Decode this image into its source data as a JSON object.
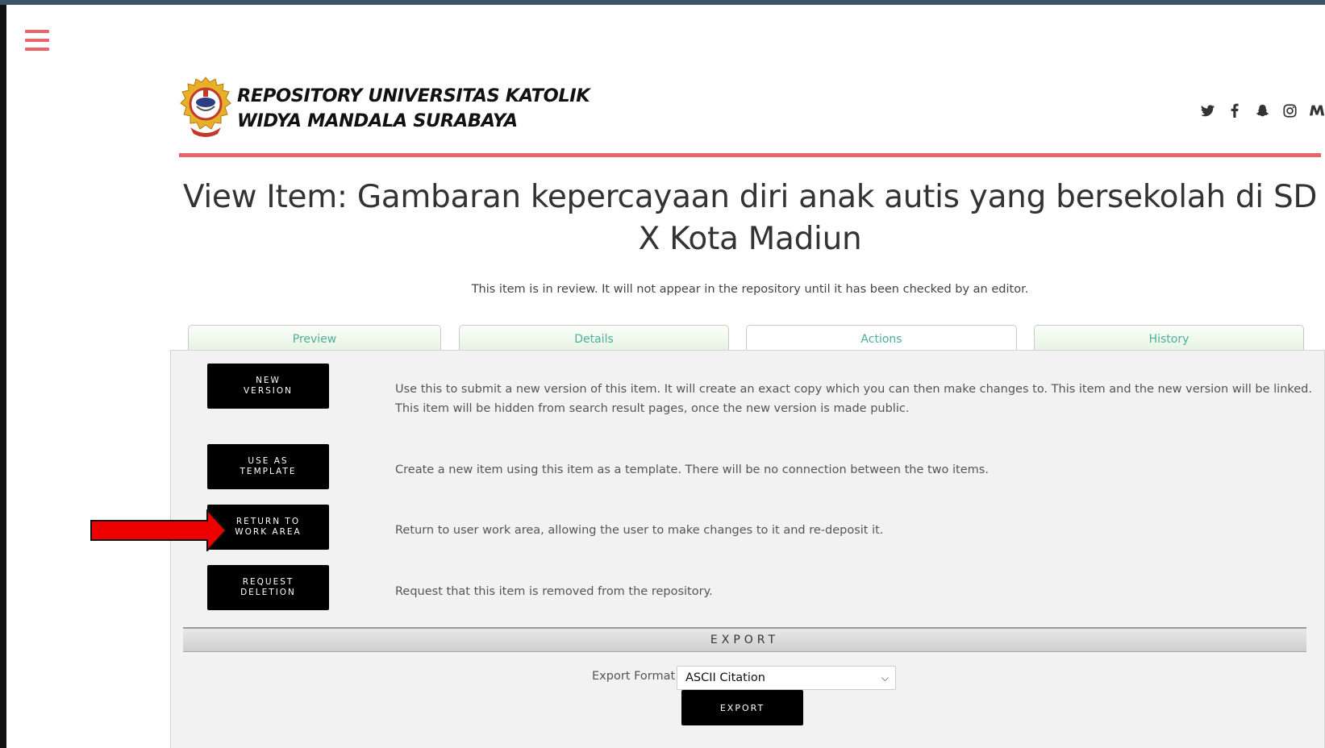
{
  "header": {
    "menu_icon": "hamburger-icon",
    "brand_line1": "REPOSITORY UNIVERSITAS KATOLIK",
    "brand_line2": "WIDYA MANDALA SURABAYA",
    "social": [
      {
        "name": "twitter-icon",
        "glyph": "🐦"
      },
      {
        "name": "facebook-icon",
        "glyph": "f"
      },
      {
        "name": "snapchat-icon",
        "glyph": "👻"
      },
      {
        "name": "instagram-icon",
        "glyph": "◎"
      },
      {
        "name": "mendeley-icon",
        "glyph": "M"
      }
    ],
    "accent_color": "#e8636a"
  },
  "page": {
    "title": "View Item: Gambaran kepercayaan diri anak autis yang bersekolah di SD X Kota Madiun",
    "review_note": "This item is in review. It will not appear in the repository until it has been checked by an editor."
  },
  "tabs": [
    {
      "label": "Preview"
    },
    {
      "label": "Details"
    },
    {
      "label": "Actions",
      "active": true
    },
    {
      "label": "History"
    }
  ],
  "actions": [
    {
      "button": "NEW\nVERSION",
      "description": "Use this to submit a new version of this item. It will create an exact copy which you can then make changes to. This item and the new version will be linked. This item will be hidden from search result pages, once the new version is made public."
    },
    {
      "button": "USE AS\nTEMPLATE",
      "description": "Create a new item using this item as a template. There will be no connection between the two items."
    },
    {
      "button": "RETURN TO\nWORK AREA",
      "description": "Return to user work area, allowing the user to make changes to it and re-deposit it."
    },
    {
      "button": "REQUEST\nDELETION",
      "description": "Request that this item is removed from the repository."
    }
  ],
  "export": {
    "heading": "EXPORT",
    "format_label": "Export Format",
    "format_value": "ASCII Citation",
    "button": "EXPORT"
  },
  "annotation": {
    "arrow_color": "#ff0000"
  }
}
